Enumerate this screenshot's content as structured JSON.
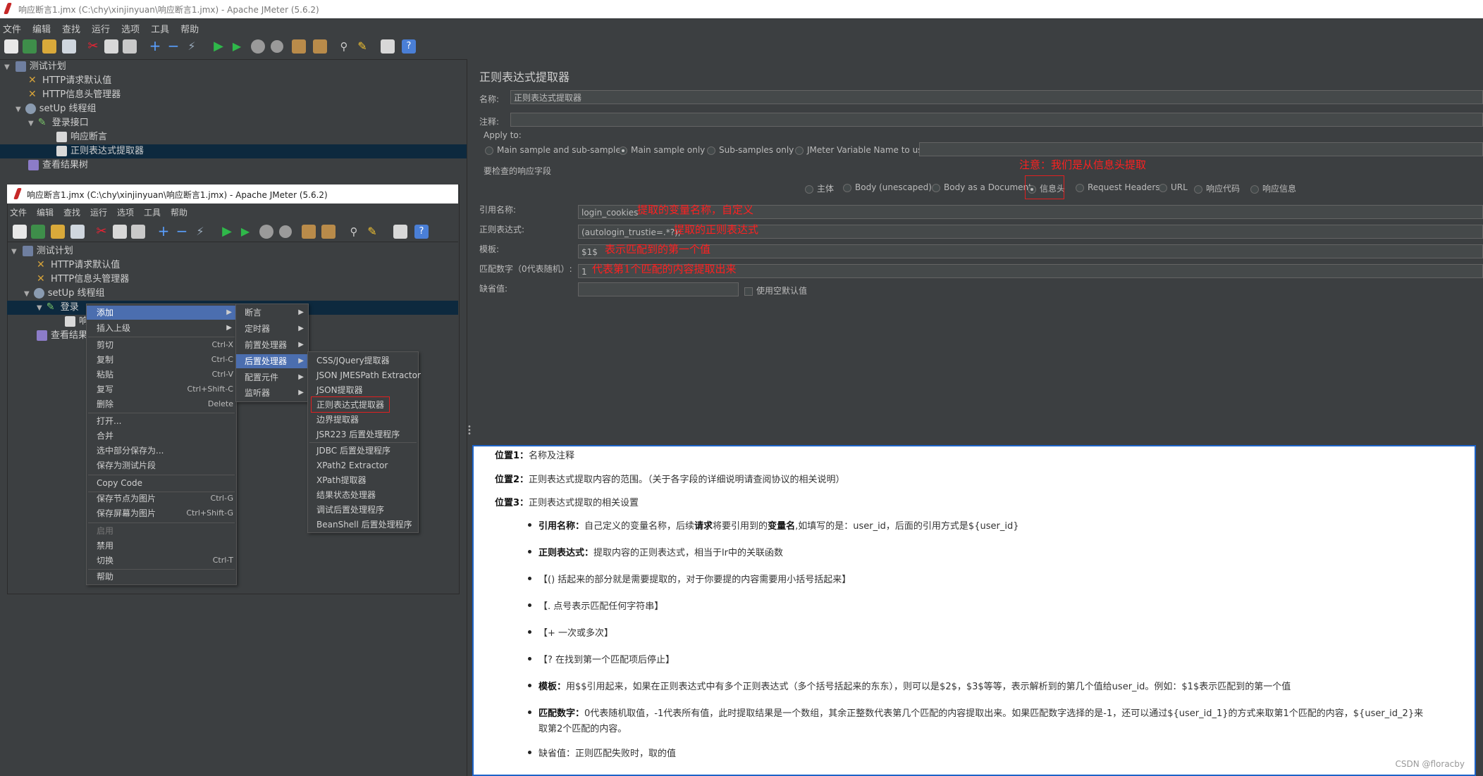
{
  "window": {
    "title": "响应断言1.jmx (C:\\chy\\xinjinyuan\\响应断言1.jmx) - Apache JMeter (5.6.2)"
  },
  "menubar": [
    "文件",
    "编辑",
    "查找",
    "运行",
    "选项",
    "工具",
    "帮助"
  ],
  "tree": {
    "items": [
      {
        "label": "测试计划"
      },
      {
        "label": "HTTP请求默认值"
      },
      {
        "label": "HTTP信息头管理器"
      },
      {
        "label": "setUp 线程组"
      },
      {
        "label": "登录接口"
      },
      {
        "label": "响应断言"
      },
      {
        "label": "正则表达式提取器"
      },
      {
        "label": "查看结果树"
      }
    ]
  },
  "overlay": {
    "title": "响应断言1.jmx (C:\\chy\\xinjinyuan\\响应断言1.jmx) - Apache JMeter (5.6.2)",
    "tree": [
      "测试计划",
      "HTTP请求默认值",
      "HTTP信息头管理器",
      "setUp 线程组",
      "登录",
      "响",
      "查看结果"
    ],
    "context_menu": [
      {
        "label": "添加",
        "shortcut": ""
      },
      {
        "label": "插入上级",
        "shortcut": ""
      },
      {
        "label": "剪切",
        "shortcut": "Ctrl-X"
      },
      {
        "label": "复制",
        "shortcut": "Ctrl-C"
      },
      {
        "label": "粘贴",
        "shortcut": "Ctrl-V"
      },
      {
        "label": "复写",
        "shortcut": "Ctrl+Shift-C"
      },
      {
        "label": "删除",
        "shortcut": "Delete"
      },
      {
        "label": "打开...",
        "shortcut": ""
      },
      {
        "label": "合并",
        "shortcut": ""
      },
      {
        "label": "选中部分保存为...",
        "shortcut": ""
      },
      {
        "label": "保存为测试片段",
        "shortcut": ""
      },
      {
        "label": "Copy Code",
        "shortcut": ""
      },
      {
        "label": "保存节点为图片",
        "shortcut": "Ctrl-G"
      },
      {
        "label": "保存屏幕为图片",
        "shortcut": "Ctrl+Shift-G"
      },
      {
        "label": "启用",
        "shortcut": ""
      },
      {
        "label": "禁用",
        "shortcut": ""
      },
      {
        "label": "切换",
        "shortcut": "Ctrl-T"
      },
      {
        "label": "帮助",
        "shortcut": ""
      }
    ],
    "submenu_add": [
      "断言",
      "定时器",
      "前置处理器",
      "后置处理器",
      "配置元件",
      "监听器"
    ],
    "submenu_post": [
      "CSS/JQuery提取器",
      "JSON JMESPath Extractor",
      "JSON提取器",
      "正则表达式提取器",
      "边界提取器",
      "JSR223 后置处理程序",
      "JDBC 后置处理程序",
      "XPath2 Extractor",
      "XPath提取器",
      "结果状态处理器",
      "调试后置处理程序",
      "BeanShell 后置处理程序"
    ]
  },
  "panel": {
    "title": "正则表达式提取器",
    "name_label": "名称:",
    "name_value": "正则表达式提取器",
    "comment_label": "注释:",
    "apply_to": "Apply to:",
    "apply_options": [
      "Main sample and sub-samples",
      "Main sample only",
      "Sub-samples only",
      "JMeter Variable Name to use"
    ],
    "field_label": "要检查的响应字段",
    "field_options": [
      "主体",
      "Body (unescaped)",
      "Body as a Document",
      "信息头",
      "Request Headers",
      "URL",
      "响应代码",
      "响应信息"
    ],
    "ref_label": "引用名称:",
    "ref_value": "login_cookies",
    "regex_label": "正则表达式:",
    "regex_value": "(autologin_trustie=.*?);",
    "template_label": "模板:",
    "template_value": "$1$",
    "match_label": "匹配数字（0代表随机）:",
    "match_value": "1",
    "default_label": "缺省值:",
    "default_check": "使用空默认值"
  },
  "annotations": {
    "note_header": "注意：我们是从信息头提取",
    "ref": "提取的变量名称，自定义",
    "regex": "提取的正则表达式",
    "template": "表示匹配到的第一个值",
    "match": "代表第1个匹配的内容提取出来"
  },
  "notes": {
    "p1_b": "位置1：",
    "p1": "名称及注释",
    "p2_b": "位置2：",
    "p2": "正则表达式提取内容的范围。（关于各字段的详细说明请查阅协议的相关说明）",
    "p3_b": "位置3：",
    "p3": "正则表达式提取的相关设置",
    "b1_b": "引用名称：",
    "b1a": "自己定义的变量名称，后续",
    "b1b": "请求",
    "b1c": "将要引用到的",
    "b1d": "变量名",
    "b1e": ",如填写的是：user_id，后面的引用方式是${user_id}",
    "b2_b": "正则表达式：",
    "b2": "提取内容的正则表达式，相当于lr中的关联函数",
    "b3": "【()    括起来的部分就是需要提取的，对于你要提的内容需要用小括号括起来】",
    "b4": "【.    点号表示匹配任何字符串】",
    "b5": "【+   一次或多次】",
    "b6": "【?    在找到第一个匹配项后停止】",
    "b7_b": "模板：",
    "b7": "用$$引用起来，如果在正则表达式中有多个正则表达式（多个括号括起来的东东），则可以是$2$，$3$等等，表示解析到的第几个值给user_id。例如：$1$表示匹配到的第一个值",
    "b8_b": "匹配数字：",
    "b8": "0代表随机取值，-1代表所有值，此时提取结果是一个数组，其余正整数代表第几个匹配的内容提取出来。如果匹配数字选择的是-1，还可以通过${user_id_1}的方式来取第1个匹配的内容，${user_id_2}来",
    "b8c": "取第2个匹配的内容。",
    "b9": "缺省值：正则匹配失败时，取的值",
    "watermark": "CSDN @floracby"
  }
}
